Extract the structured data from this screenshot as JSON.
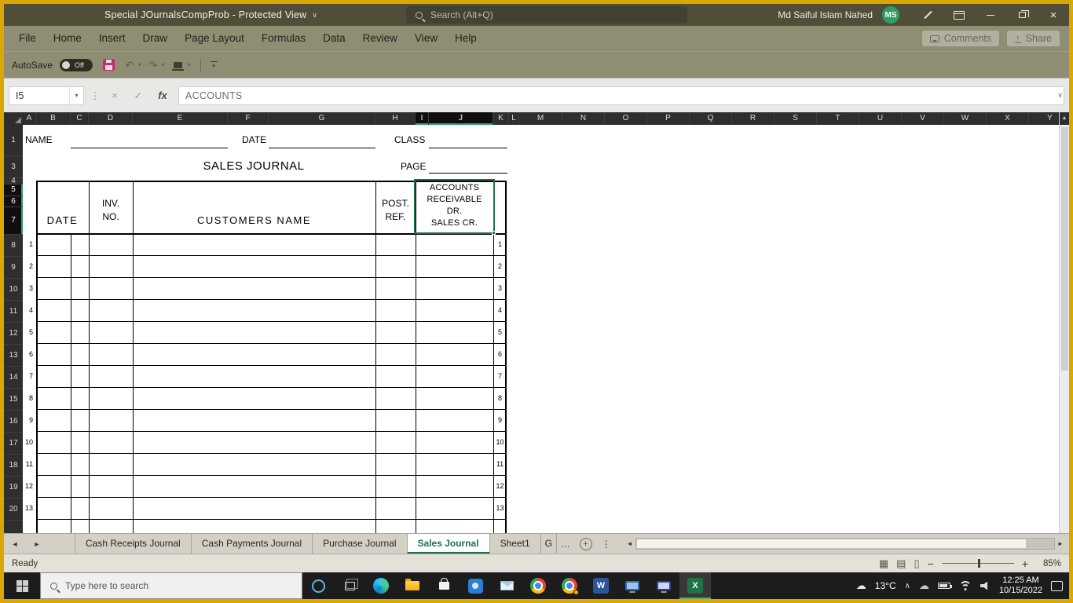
{
  "titlebar": {
    "title": "Special JOurnalsCompProb - Protected View",
    "search_placeholder": "Search (Alt+Q)",
    "user_name": "Md Saiful Islam Nahed",
    "user_initials": "MS"
  },
  "ribbon": {
    "tabs": [
      "File",
      "Home",
      "Insert",
      "Draw",
      "Page Layout",
      "Formulas",
      "Data",
      "Review",
      "View",
      "Help"
    ],
    "comments": "Comments",
    "share": "Share",
    "autosave": "AutoSave",
    "autosave_state": "Off"
  },
  "formula_bar": {
    "cell_ref": "I5",
    "value": "ACCOUNTS"
  },
  "grid": {
    "col_letters": [
      "A",
      "B",
      "C",
      "D",
      "E",
      "F",
      "G",
      "H",
      "I",
      "J",
      "K",
      "L",
      "M",
      "N",
      "O",
      "P",
      "Q",
      "R",
      "S",
      "T",
      "U",
      "V",
      "W",
      "X",
      "Y"
    ],
    "selected_cols": [
      "I",
      "J"
    ],
    "row_labels": [
      "1",
      "3",
      "4",
      "5",
      "6",
      "7",
      "8",
      "9",
      "10",
      "11",
      "12",
      "13",
      "14",
      "15",
      "16",
      "17",
      "18",
      "19",
      "20"
    ],
    "selected_rows": [
      "5",
      "6",
      "7"
    ]
  },
  "worksheet": {
    "name_label": "NAME",
    "date_label": "DATE",
    "class_label": "CLASS",
    "title": "SALES JOURNAL",
    "page_label": "PAGE",
    "headers": {
      "date": "DATE",
      "inv_no": "INV.\nNO.",
      "customers_name": "CUSTOMERS NAME",
      "post_ref": "POST.\nREF.",
      "accounts": "ACCOUNTS\nRECEIVABLE\nDR.\nSALES CR."
    },
    "line_numbers": [
      "1",
      "2",
      "3",
      "4",
      "5",
      "6",
      "7",
      "8",
      "9",
      "10",
      "11",
      "12",
      "13"
    ]
  },
  "sheet_tabs": {
    "tabs": [
      {
        "label": "Cash Receipts Journal",
        "active": false,
        "truncated": false
      },
      {
        "label": "Cash Payments Journal",
        "active": false,
        "truncated": false
      },
      {
        "label": "Purchase Journal",
        "active": false,
        "truncated": false
      },
      {
        "label": "Sales Journal",
        "active": true,
        "truncated": false
      },
      {
        "label": "Sheet1",
        "active": false,
        "truncated": false
      },
      {
        "label": "G",
        "active": false,
        "truncated": true
      }
    ],
    "overflow": "…"
  },
  "status_bar": {
    "mode": "Ready",
    "zoom": "85%"
  },
  "taskbar": {
    "search_placeholder": "Type here to search",
    "temperature": "13°C",
    "time": "12:25 AM",
    "date": "10/15/2022"
  },
  "icons": {
    "title_chevron": "∨",
    "close": "×",
    "undo": "↶",
    "redo": "↷",
    "dropdown": "▾",
    "cancel": "×",
    "check": "✓",
    "fx": "fx",
    "formula_dots": "⋮",
    "formula_expand": "∨",
    "scroll_up": "▲",
    "tab_left": "◄",
    "tab_right": "►",
    "add_sheet": "+",
    "more_v": "⋮",
    "view_normal": "▦",
    "view_layout": "▤",
    "view_break": "▯",
    "zoom_out": "−",
    "zoom_in": "+",
    "cloud": "☁",
    "chevron_up": "∧",
    "word_logo": "W",
    "excel_logo": "X"
  },
  "colors": {
    "accent_green": "#1E7145",
    "titlebar": "#504E38",
    "ribbon": "#8F8E74",
    "gold_border": "#D9A700"
  }
}
